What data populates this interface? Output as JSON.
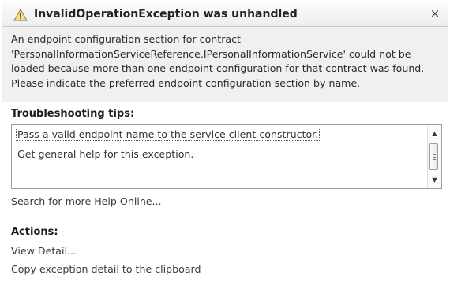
{
  "dialog": {
    "title": "InvalidOperationException was unhandled",
    "title_icon": "warning-icon",
    "close_glyph": "×",
    "message": "An endpoint configuration section for contract 'PersonalInformationServiceReference.IPersonalInformationService' could not be loaded because more than one endpoint configuration for that contract was found. Please indicate the preferred endpoint configuration section by name."
  },
  "troubleshooting": {
    "heading": "Troubleshooting tips:",
    "tips": [
      "Pass a valid endpoint name to the service client constructor.",
      "Get general help for this exception."
    ],
    "search_link": "Search for more Help Online..."
  },
  "actions": {
    "heading": "Actions:",
    "items": [
      "View Detail...",
      "Copy exception detail to the clipboard"
    ]
  }
}
